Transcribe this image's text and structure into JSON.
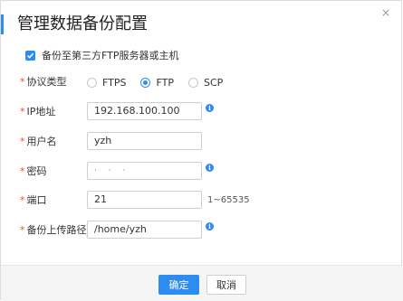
{
  "dialog": {
    "title": "管理数据备份配置",
    "close_symbol": "×"
  },
  "backup_checkbox": {
    "label": "备份至第三方FTP服务器或主机",
    "checked": true
  },
  "form": {
    "required_mark": "*",
    "protocol": {
      "label": "协议类型",
      "options": [
        "FTPS",
        "FTP",
        "SCP"
      ],
      "selected": "FTP"
    },
    "ip": {
      "label": "IP地址",
      "value": "192.168.100.100"
    },
    "username": {
      "label": "用户名",
      "value": "yzh"
    },
    "password": {
      "label": "密码",
      "value": "· · ·"
    },
    "port": {
      "label": "端口",
      "value": "21",
      "hint": "1~65535"
    },
    "upload_path": {
      "label": "备份上传路径",
      "value": "/home/yzh"
    }
  },
  "info_icon_glyph": "i",
  "footer": {
    "confirm_label": "确定",
    "cancel_label": "取消"
  },
  "colors": {
    "accent": "#2d8cf0",
    "required": "#e74c3c"
  }
}
